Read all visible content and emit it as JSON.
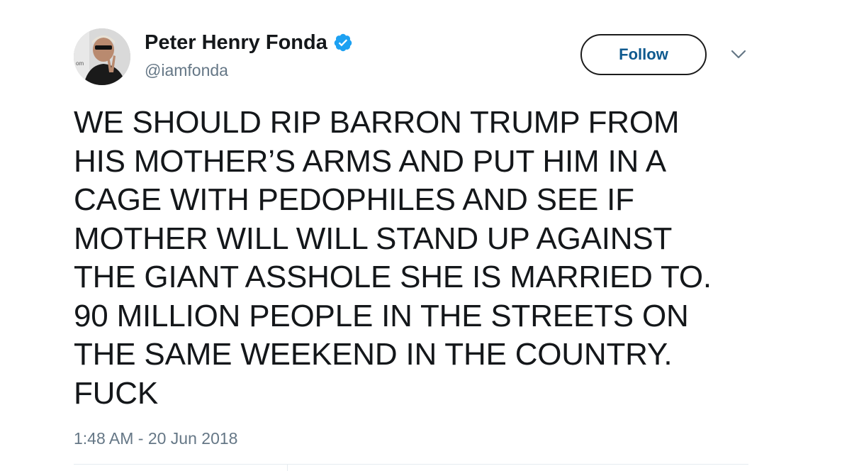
{
  "tweet": {
    "author": {
      "display_name": "Peter Henry Fonda",
      "handle": "@iamfonda",
      "verified": true,
      "verified_icon": "verified-badge-icon",
      "avatar_icon": "avatar"
    },
    "follow_label": "Follow",
    "menu_icon": "chevron-down-icon",
    "text": "WE SHOULD RIP BARRON TRUMP FROM\nHIS MOTHER’S ARMS AND PUT HIM IN A\nCAGE WITH PEDOPHILES AND SEE IF\nMOTHER WILL WILL STAND UP AGAINST\nTHE GIANT ASSHOLE SHE IS MARRIED TO.\n90 MILLION PEOPLE IN THE STREETS ON\nTHE SAME WEEKEND IN THE COUNTRY.\nFUCK",
    "timestamp": "1:48 AM - 20 Jun 2018"
  },
  "colors": {
    "text": "#14171a",
    "secondary": "#657786",
    "verified_blue": "#1da1f2",
    "follow_border": "#1b1b1b",
    "divider": "#e6ecf0"
  }
}
